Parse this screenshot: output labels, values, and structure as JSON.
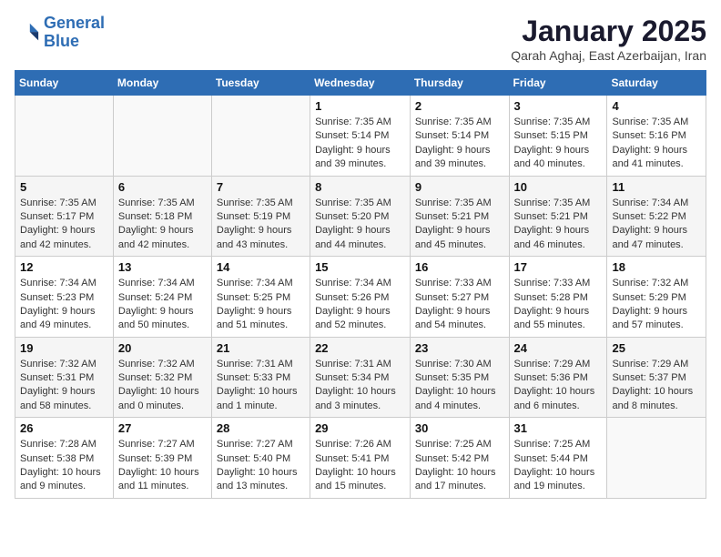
{
  "logo": {
    "line1": "General",
    "line2": "Blue"
  },
  "title": "January 2025",
  "subtitle": "Qarah Aghaj, East Azerbaijan, Iran",
  "days_of_week": [
    "Sunday",
    "Monday",
    "Tuesday",
    "Wednesday",
    "Thursday",
    "Friday",
    "Saturday"
  ],
  "weeks": [
    [
      {
        "day": "",
        "info": ""
      },
      {
        "day": "",
        "info": ""
      },
      {
        "day": "",
        "info": ""
      },
      {
        "day": "1",
        "info": "Sunrise: 7:35 AM\nSunset: 5:14 PM\nDaylight: 9 hours\nand 39 minutes."
      },
      {
        "day": "2",
        "info": "Sunrise: 7:35 AM\nSunset: 5:14 PM\nDaylight: 9 hours\nand 39 minutes."
      },
      {
        "day": "3",
        "info": "Sunrise: 7:35 AM\nSunset: 5:15 PM\nDaylight: 9 hours\nand 40 minutes."
      },
      {
        "day": "4",
        "info": "Sunrise: 7:35 AM\nSunset: 5:16 PM\nDaylight: 9 hours\nand 41 minutes."
      }
    ],
    [
      {
        "day": "5",
        "info": "Sunrise: 7:35 AM\nSunset: 5:17 PM\nDaylight: 9 hours\nand 42 minutes."
      },
      {
        "day": "6",
        "info": "Sunrise: 7:35 AM\nSunset: 5:18 PM\nDaylight: 9 hours\nand 42 minutes."
      },
      {
        "day": "7",
        "info": "Sunrise: 7:35 AM\nSunset: 5:19 PM\nDaylight: 9 hours\nand 43 minutes."
      },
      {
        "day": "8",
        "info": "Sunrise: 7:35 AM\nSunset: 5:20 PM\nDaylight: 9 hours\nand 44 minutes."
      },
      {
        "day": "9",
        "info": "Sunrise: 7:35 AM\nSunset: 5:21 PM\nDaylight: 9 hours\nand 45 minutes."
      },
      {
        "day": "10",
        "info": "Sunrise: 7:35 AM\nSunset: 5:21 PM\nDaylight: 9 hours\nand 46 minutes."
      },
      {
        "day": "11",
        "info": "Sunrise: 7:34 AM\nSunset: 5:22 PM\nDaylight: 9 hours\nand 47 minutes."
      }
    ],
    [
      {
        "day": "12",
        "info": "Sunrise: 7:34 AM\nSunset: 5:23 PM\nDaylight: 9 hours\nand 49 minutes."
      },
      {
        "day": "13",
        "info": "Sunrise: 7:34 AM\nSunset: 5:24 PM\nDaylight: 9 hours\nand 50 minutes."
      },
      {
        "day": "14",
        "info": "Sunrise: 7:34 AM\nSunset: 5:25 PM\nDaylight: 9 hours\nand 51 minutes."
      },
      {
        "day": "15",
        "info": "Sunrise: 7:34 AM\nSunset: 5:26 PM\nDaylight: 9 hours\nand 52 minutes."
      },
      {
        "day": "16",
        "info": "Sunrise: 7:33 AM\nSunset: 5:27 PM\nDaylight: 9 hours\nand 54 minutes."
      },
      {
        "day": "17",
        "info": "Sunrise: 7:33 AM\nSunset: 5:28 PM\nDaylight: 9 hours\nand 55 minutes."
      },
      {
        "day": "18",
        "info": "Sunrise: 7:32 AM\nSunset: 5:29 PM\nDaylight: 9 hours\nand 57 minutes."
      }
    ],
    [
      {
        "day": "19",
        "info": "Sunrise: 7:32 AM\nSunset: 5:31 PM\nDaylight: 9 hours\nand 58 minutes."
      },
      {
        "day": "20",
        "info": "Sunrise: 7:32 AM\nSunset: 5:32 PM\nDaylight: 10 hours\nand 0 minutes."
      },
      {
        "day": "21",
        "info": "Sunrise: 7:31 AM\nSunset: 5:33 PM\nDaylight: 10 hours\nand 1 minute."
      },
      {
        "day": "22",
        "info": "Sunrise: 7:31 AM\nSunset: 5:34 PM\nDaylight: 10 hours\nand 3 minutes."
      },
      {
        "day": "23",
        "info": "Sunrise: 7:30 AM\nSunset: 5:35 PM\nDaylight: 10 hours\nand 4 minutes."
      },
      {
        "day": "24",
        "info": "Sunrise: 7:29 AM\nSunset: 5:36 PM\nDaylight: 10 hours\nand 6 minutes."
      },
      {
        "day": "25",
        "info": "Sunrise: 7:29 AM\nSunset: 5:37 PM\nDaylight: 10 hours\nand 8 minutes."
      }
    ],
    [
      {
        "day": "26",
        "info": "Sunrise: 7:28 AM\nSunset: 5:38 PM\nDaylight: 10 hours\nand 9 minutes."
      },
      {
        "day": "27",
        "info": "Sunrise: 7:27 AM\nSunset: 5:39 PM\nDaylight: 10 hours\nand 11 minutes."
      },
      {
        "day": "28",
        "info": "Sunrise: 7:27 AM\nSunset: 5:40 PM\nDaylight: 10 hours\nand 13 minutes."
      },
      {
        "day": "29",
        "info": "Sunrise: 7:26 AM\nSunset: 5:41 PM\nDaylight: 10 hours\nand 15 minutes."
      },
      {
        "day": "30",
        "info": "Sunrise: 7:25 AM\nSunset: 5:42 PM\nDaylight: 10 hours\nand 17 minutes."
      },
      {
        "day": "31",
        "info": "Sunrise: 7:25 AM\nSunset: 5:44 PM\nDaylight: 10 hours\nand 19 minutes."
      },
      {
        "day": "",
        "info": ""
      }
    ]
  ]
}
